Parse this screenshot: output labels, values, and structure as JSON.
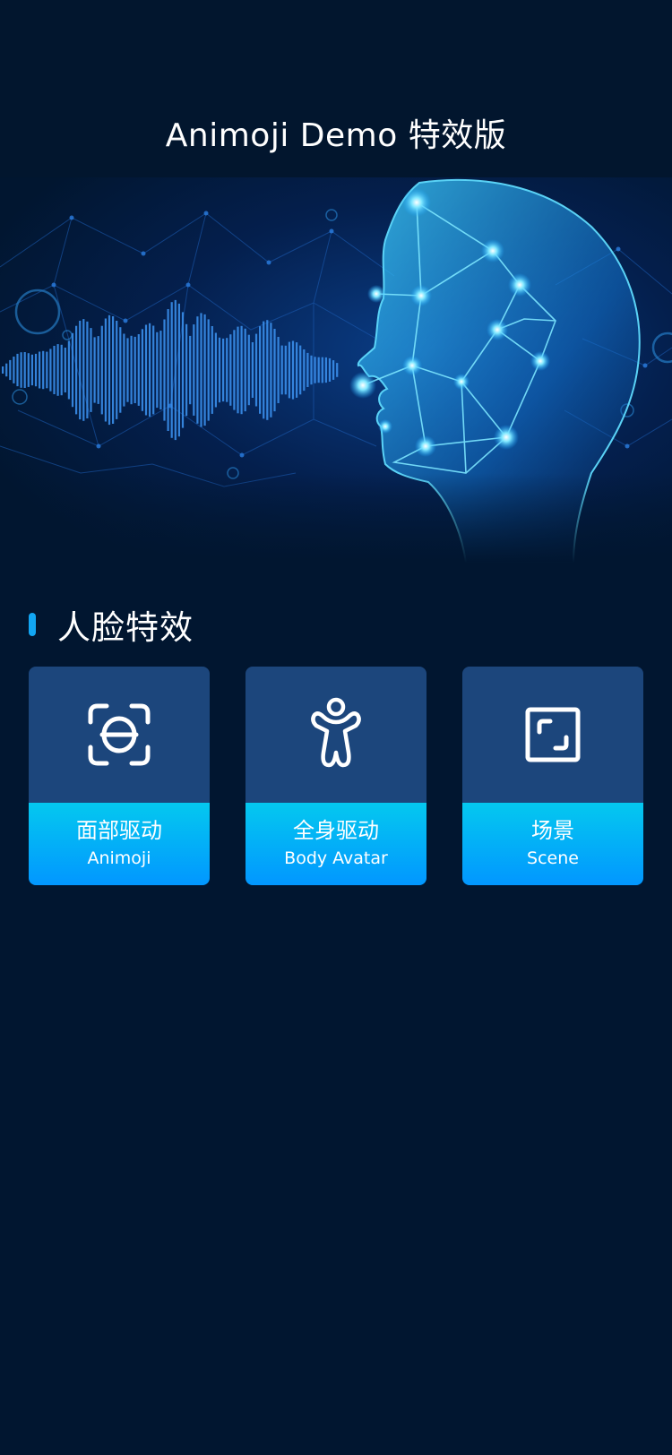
{
  "header": {
    "title": "Animoji Demo 特效版"
  },
  "banner": {
    "image": "ai-face-soundwave-illustration"
  },
  "section": {
    "title": "人脸特效"
  },
  "cards": [
    {
      "icon": "face-scan-icon",
      "label_cn": "面部驱动",
      "label_en": "Animoji"
    },
    {
      "icon": "body-figure-icon",
      "label_cn": "全身驱动",
      "label_en": "Body Avatar"
    },
    {
      "icon": "scene-frame-icon",
      "label_cn": "场景",
      "label_en": "Scene"
    }
  ],
  "colors": {
    "background": "#011630",
    "card_top": "#1c467c",
    "card_gradient_start": "#04c8ef",
    "card_gradient_end": "#0297ff",
    "accent": "#12a6f3"
  }
}
